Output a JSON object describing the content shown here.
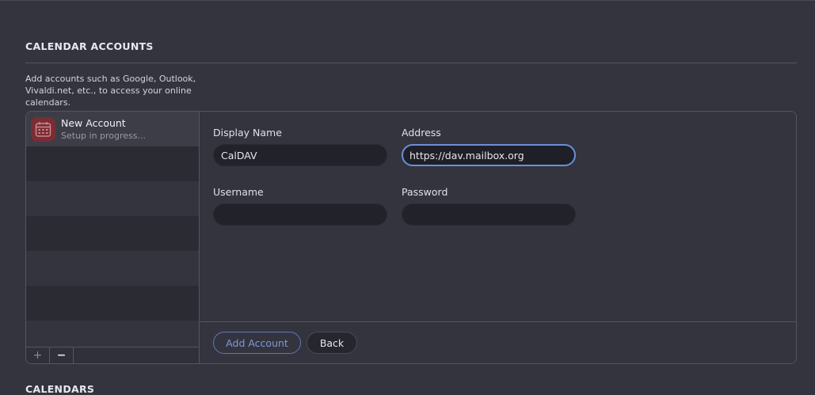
{
  "section": {
    "title": "CALENDAR ACCOUNTS",
    "description": "Add accounts such as Google, Outlook, Vivaldi.net, etc., to access your online calendars."
  },
  "accounts": [
    {
      "name": "New Account",
      "status": "Setup in progress...",
      "icon": "calendar-icon",
      "selected": true
    }
  ],
  "list_toolbar": {
    "add_label": "+",
    "remove_label": "−"
  },
  "form": {
    "display_name": {
      "label": "Display Name",
      "value": "CalDAV"
    },
    "address": {
      "label": "Address",
      "value": "https://dav.mailbox.org"
    },
    "username": {
      "label": "Username",
      "value": ""
    },
    "password": {
      "label": "Password",
      "value": ""
    }
  },
  "buttons": {
    "add_account": "Add Account",
    "back": "Back"
  },
  "next_section": {
    "title": "CALENDARS"
  },
  "colors": {
    "background": "#34343f",
    "accent": "#6b8fd8",
    "account_icon": "#7a2d33"
  }
}
